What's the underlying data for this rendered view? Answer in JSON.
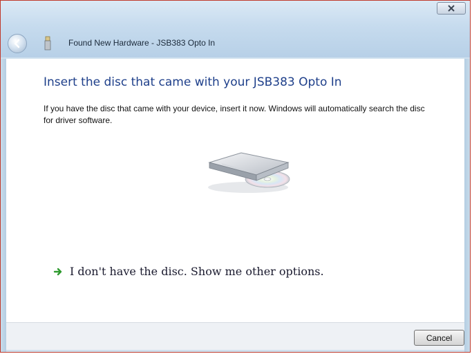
{
  "window": {
    "title": "Found New Hardware - JSB383 Opto In"
  },
  "titlebar_icons": {
    "back": "back-arrow-icon",
    "device": "usb-device-icon",
    "close": "close-x-icon"
  },
  "content": {
    "heading": "Insert the disc that came with your JSB383 Opto In",
    "instructions": "If you have the disc that came with your device, insert it now.  Windows will automatically search the disc for driver software.",
    "illustration": "optical-drive-disc-icon"
  },
  "options": {
    "no_disc_link": "I don't have the disc.  Show me other options.",
    "link_icon": "green-arrow-icon"
  },
  "footer": {
    "cancel_label": "Cancel"
  },
  "colors": {
    "heading": "#1e3f8a",
    "window_border": "#c0392b",
    "arrow": "#2f9a2f"
  }
}
